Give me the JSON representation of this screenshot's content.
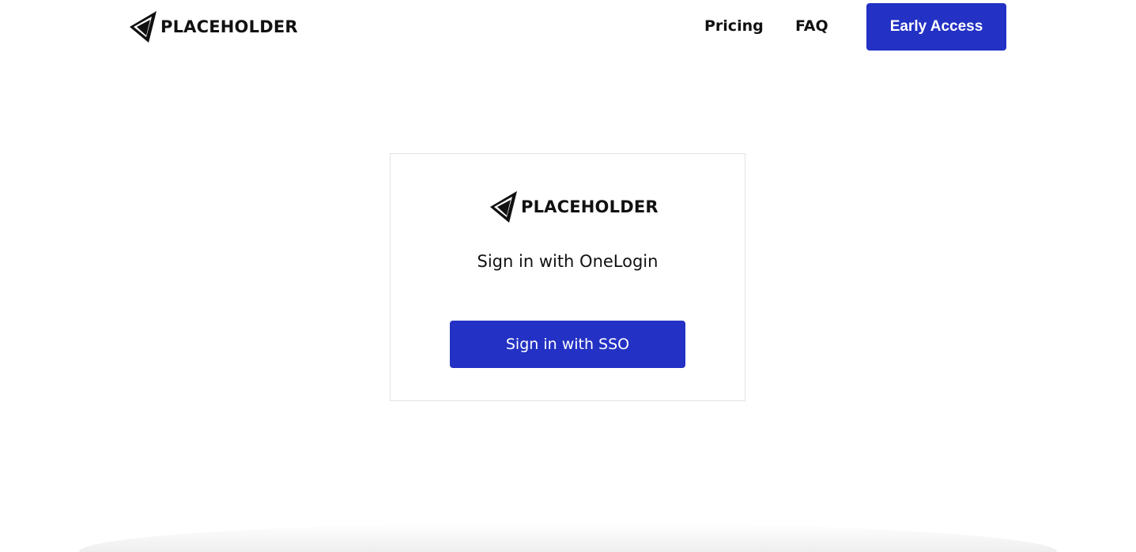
{
  "brand": {
    "name": "PLACEHOLDER",
    "logo_icon": "paper-plane-icon"
  },
  "header": {
    "nav": {
      "pricing_label": "Pricing",
      "faq_label": "FAQ"
    },
    "cta_label": "Early Access"
  },
  "signin_card": {
    "heading": "Sign in with OneLogin",
    "sso_button_label": "Sign in with SSO"
  },
  "colors": {
    "accent": "#2331c4",
    "text": "#111111",
    "card_border": "#e3e3e3",
    "background": "#ffffff"
  }
}
